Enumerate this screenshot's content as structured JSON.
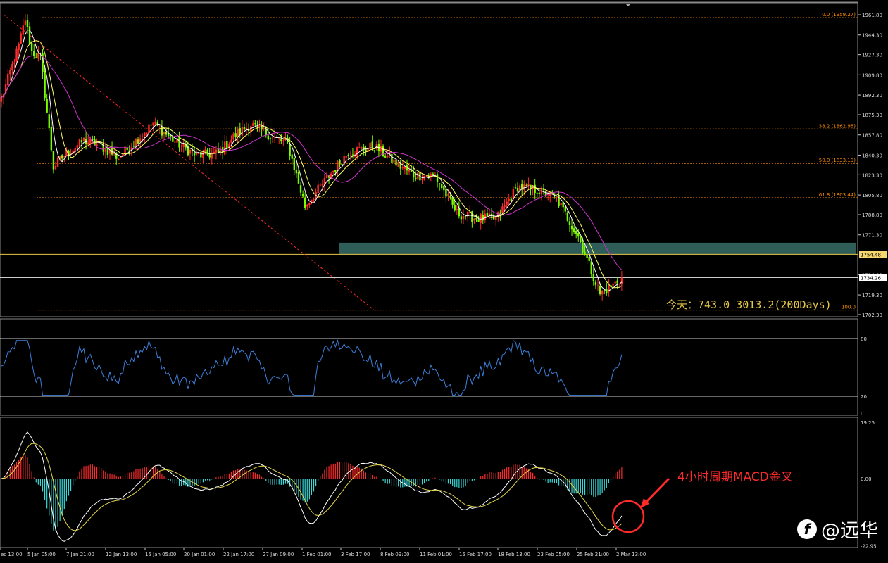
{
  "colors": {
    "background": "#000000",
    "bull": "#ff2a2a",
    "bear": "#7cfc00",
    "ma_fast": "#ffffff",
    "ma_mid": "#ffff66",
    "ma_slow": "#cc33cc",
    "fib_line": "#ff8c00",
    "trend_line": "#ff2a2a",
    "zone": "#2f5d57",
    "rsi": "#3d7fd9",
    "macd_pos": "#ff2a2a",
    "macd_neg": "#3ad7d7",
    "annotation": "#ff2a2a"
  },
  "annotation": {
    "today_text": "今天：743.0   3013.2(200Days)",
    "macd_note": "4小时周期MACD金叉"
  },
  "watermark": {
    "logo_icon": "weibo-f-logo-icon",
    "text": "@远华"
  },
  "chart_data": [
    {
      "type": "candlestick",
      "panel": "price",
      "y_ticks": [
        1961.8,
        1944.3,
        1927.3,
        1909.8,
        1892.3,
        1875.3,
        1857.8,
        1840.3,
        1823.3,
        1805.8,
        1788.8,
        1771.3,
        1736.8,
        1719.3,
        1702.3
      ],
      "ylim": [
        1700,
        1968
      ],
      "x_ticks": [
        "ec 13:00",
        "5 Jan 05:00",
        "7 Jan 21:00",
        "12 Jan 13:00",
        "15 Jan 05:00",
        "20 Jan 01:00",
        "22 Jan 17:00",
        "27 Jan 09:00",
        "1 Feb 01:00",
        "3 Feb 17:00",
        "8 Feb 09:00",
        "11 Feb 01:00",
        "15 Feb 17:00",
        "18 Feb 13:00",
        "23 Feb 05:00",
        "25 Feb 21:00",
        "2 Mar 13:00"
      ],
      "fib_levels": [
        {
          "label": "0.0 (1959.27)",
          "value": 1959.27
        },
        {
          "label": "38.2 (1862.95)",
          "value": 1862.95
        },
        {
          "label": "50.0 (1833.19)",
          "value": 1833.19
        },
        {
          "label": "61.8 (1803.44)",
          "value": 1803.44
        },
        {
          "label": "100.0",
          "value": 1706.2
        }
      ],
      "price_markers": [
        {
          "label": "1754.48",
          "value": 1754.48,
          "style": "highlight"
        },
        {
          "label": "1734.26",
          "value": 1734.26,
          "style": "current"
        }
      ],
      "zone": {
        "from": 1754.48,
        "to": 1764.5
      },
      "trend_line": {
        "from": [
          1,
          1962
        ],
        "to": [
          172,
          1706
        ]
      },
      "path_anchors": [
        [
          0,
          1889
        ],
        [
          8,
          1935
        ],
        [
          11,
          1958
        ],
        [
          14,
          1930
        ],
        [
          18,
          1925
        ],
        [
          24,
          1830
        ],
        [
          30,
          1842
        ],
        [
          38,
          1853
        ],
        [
          46,
          1848
        ],
        [
          54,
          1838
        ],
        [
          62,
          1853
        ],
        [
          70,
          1868
        ],
        [
          80,
          1852
        ],
        [
          90,
          1840
        ],
        [
          100,
          1842
        ],
        [
          108,
          1858
        ],
        [
          115,
          1867
        ],
        [
          125,
          1856
        ],
        [
          132,
          1850
        ],
        [
          140,
          1796
        ],
        [
          150,
          1820
        ],
        [
          160,
          1843
        ],
        [
          172,
          1848
        ],
        [
          182,
          1833
        ],
        [
          190,
          1823
        ],
        [
          200,
          1822
        ],
        [
          210,
          1790
        ],
        [
          218,
          1786
        ],
        [
          228,
          1785
        ],
        [
          238,
          1813
        ],
        [
          247,
          1810
        ],
        [
          256,
          1802
        ],
        [
          266,
          1770
        ],
        [
          276,
          1720
        ],
        [
          282,
          1728
        ],
        [
          286,
          1734
        ]
      ]
    },
    {
      "type": "line",
      "panel": "rsi",
      "y_ticks": [
        80,
        20,
        0
      ],
      "ylim": [
        0,
        100
      ]
    },
    {
      "type": "bar",
      "panel": "macd",
      "y_ticks": [
        19.25,
        0.0,
        -22.95
      ],
      "ylim": [
        -22.95,
        19.25
      ]
    }
  ]
}
